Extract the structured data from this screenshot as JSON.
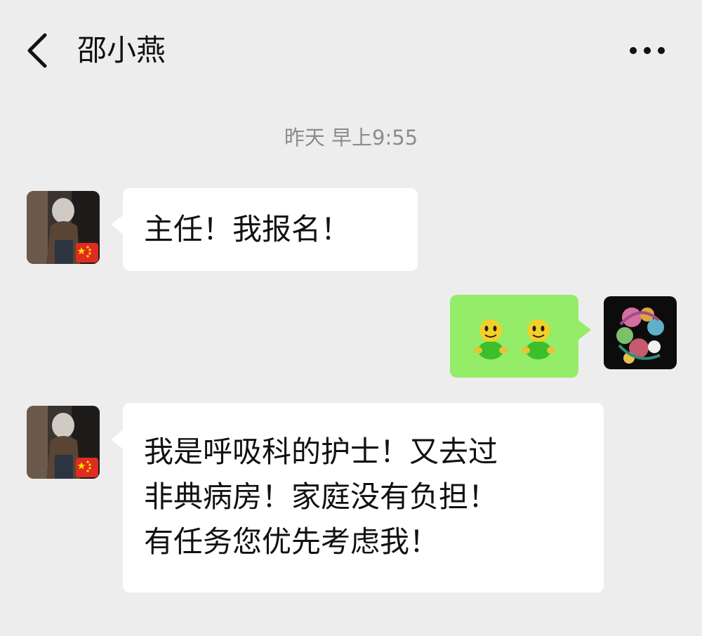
{
  "header": {
    "back_icon": "back-chevron-icon",
    "title": "邵小燕",
    "more_icon": "more-dots-icon"
  },
  "chat": {
    "timestamp": "昨天 早上9:55",
    "messages": [
      {
        "side": "left",
        "avatar_icon": "contact-avatar-photo",
        "badge_icon": "china-flag-badge-icon",
        "lines": [
          "主任！我报名！"
        ]
      },
      {
        "side": "right",
        "avatar_icon": "floral-letter-avatar",
        "content": "two-emoji-stickers",
        "lines": []
      },
      {
        "side": "left",
        "avatar_icon": "contact-avatar-photo",
        "badge_icon": "china-flag-badge-icon",
        "lines": [
          "我是呼吸科的护士！又去过",
          "非典病房！家庭没有负担！",
          "有任务您优先考虑我！"
        ]
      }
    ]
  },
  "colors": {
    "background": "#ededed",
    "bubble_left": "#ffffff",
    "bubble_right": "#95ec69",
    "timestamp_text": "#8c8c8c"
  }
}
